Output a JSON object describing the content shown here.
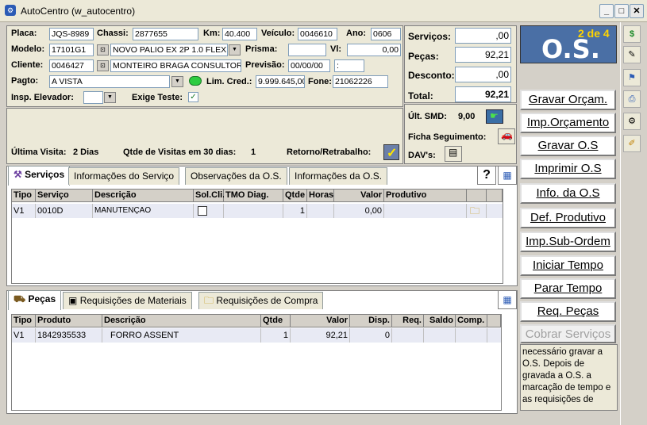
{
  "window": {
    "title": "AutoCentro (w_autocentro)"
  },
  "vehicle": {
    "placa_label": "Placa:",
    "placa": "JQS-8989",
    "chassi_label": "Chassi:",
    "chassi": "2877655",
    "km_label": "Km:",
    "km": "40.400",
    "veiculo_label": "Veículo:",
    "veiculo": "0046610",
    "ano_label": "Ano:",
    "ano": "0606",
    "modelo_label": "Modelo:",
    "modelo_code": "17101G1",
    "modelo_desc": "NOVO PALIO EX 2P 1.0 FLEX",
    "prisma_label": "Prisma:",
    "prisma": "",
    "vl_label": "Vl:",
    "vl": "0,00",
    "cliente_label": "Cliente:",
    "cliente_code": "0046427",
    "cliente_name": "MONTEIRO BRAGA CONSULTORIA",
    "previsao_label": "Previsão:",
    "previsao_date": "00/00/00",
    "previsao_time": ":",
    "pagto_label": "Pagto:",
    "pagto": "A VISTA",
    "limcred_label": "Lim. Cred.:",
    "limcred": "9.999.645,00",
    "fone_label": "Fone:",
    "fone": "21062226",
    "insp_label": "Insp. Elevador:",
    "insp": "",
    "exige_label": "Exige Teste:",
    "exige_checked": "✓"
  },
  "totals": {
    "servicos_label": "Serviços:",
    "servicos": ",00",
    "pecas_label": "Peças:",
    "pecas": "92,21",
    "desconto_label": "Desconto:",
    "desconto": ",00",
    "total_label": "Total:",
    "total": "92,21"
  },
  "smd": {
    "ult_label": "Últ. SMD:",
    "ult_value": "9,00",
    "ficha_label": "Ficha  Seguimento:",
    "davs_label": "DAV's:"
  },
  "visits": {
    "ultima_label": "Última Visita:",
    "ultima_value": "2 Dias",
    "qtde_label": "Qtde de Visitas em 30 dias:",
    "qtde_value": "1",
    "retorno_label": "Retorno/Retrabalho:"
  },
  "os_badge": {
    "count": "2 de 4",
    "title": "O.S."
  },
  "side_buttons": [
    "Gravar Orçam.",
    "Imp.Orçamento",
    "Gravar O.S",
    "Imprimir O.S",
    "Info. da O.S",
    "Def. Produtivo",
    "Imp.Sub-Ordem",
    "Iniciar Tempo",
    "Parar Tempo",
    "Req. Peças",
    "Cobrar Serviços"
  ],
  "info_note": "necessário gravar a O.S. Depois de gravada a O.S. a marcação de tempo e as requisições de",
  "service_tabs": [
    "Serviços",
    "Informações do Serviço",
    "Observações da O.S.",
    "Informações da O.S."
  ],
  "service_grid": {
    "headers": [
      "Tipo",
      "Serviço",
      "Descrição",
      "Sol.Cli.",
      "TMO Diag.",
      "Qtde",
      "Horas",
      "Valor",
      "Produtivo"
    ],
    "rows": [
      {
        "tipo": "V1",
        "servico": "0010D",
        "descricao": "MANUTENÇAO",
        "qtde": "1",
        "valor": "0,00"
      }
    ]
  },
  "parts_tabs": [
    "Peças",
    "Requisições de Materiais",
    "Requisições de Compra"
  ],
  "parts_grid": {
    "headers": [
      "Tipo",
      "Produto",
      "Descrição",
      "Qtde",
      "Valor",
      "Disp.",
      "Req.",
      "Saldo",
      "Comp."
    ],
    "rows": [
      {
        "tipo": "V1",
        "produto": "1842935533",
        "descricao": "FORRO ASSENT",
        "qtde": "1",
        "valor": "92,21",
        "disp": "0"
      }
    ]
  },
  "right_toolbar": [
    "dollar-icon",
    "edit-icon",
    "flag-icon",
    "printer-icon",
    "gear-icon",
    "pencil-icon"
  ]
}
